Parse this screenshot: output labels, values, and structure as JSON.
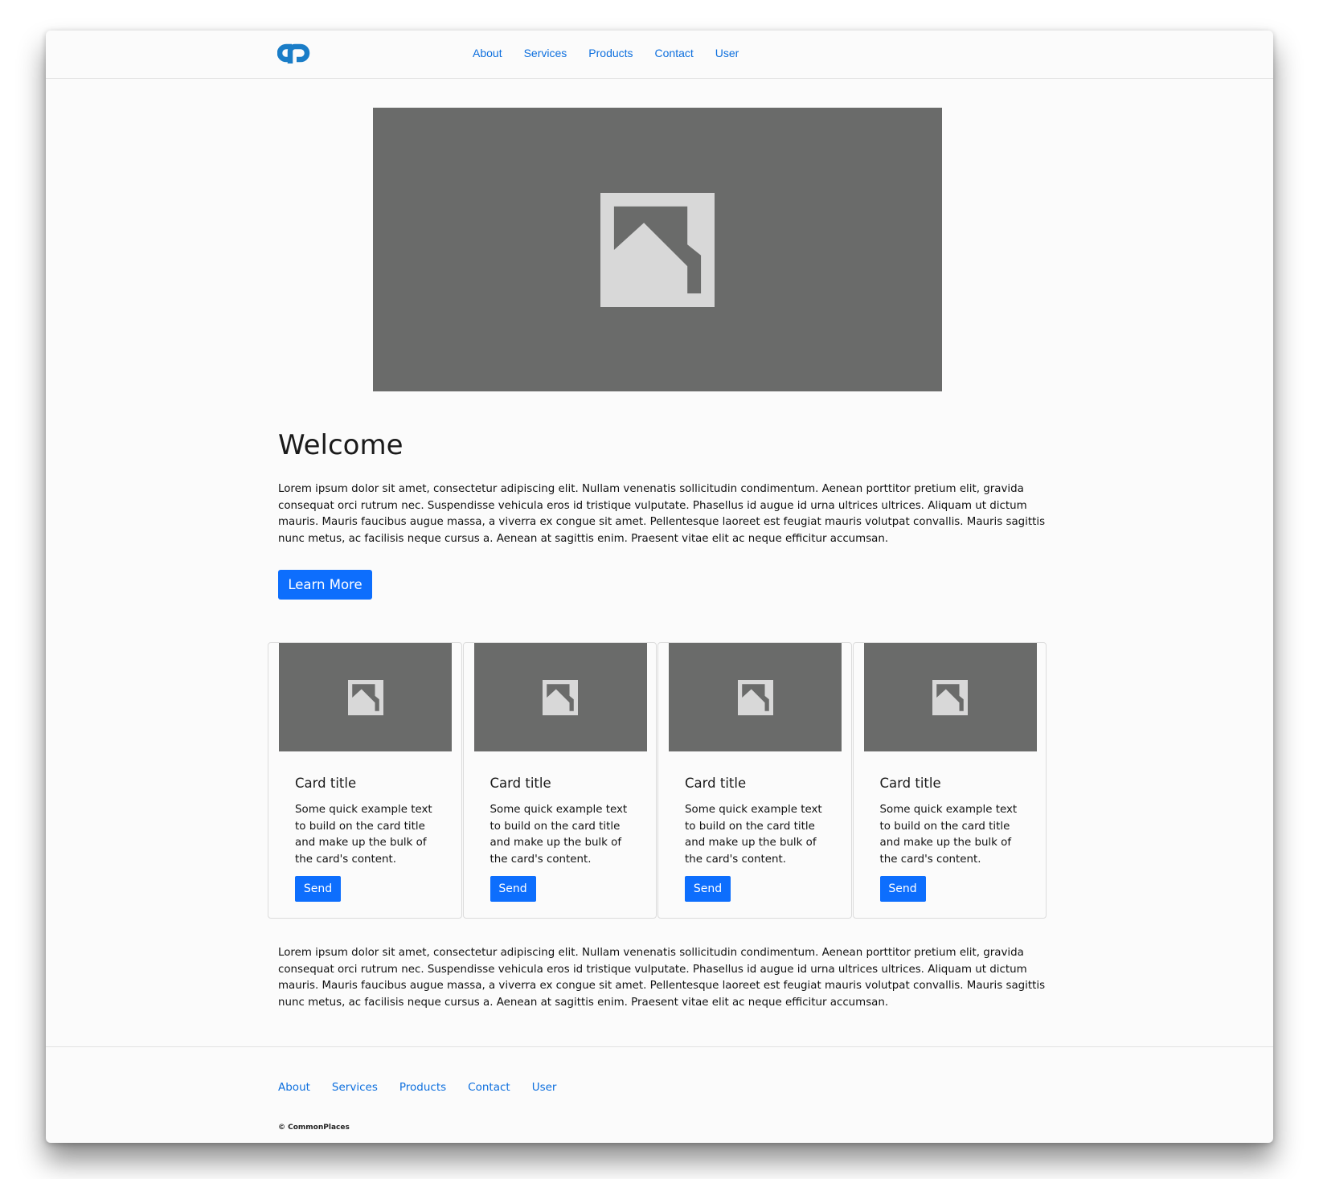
{
  "brand": {
    "logo_icon": "commonplaces-logo-icon",
    "color": "#1a7dc7"
  },
  "nav": {
    "items": [
      {
        "label": "About"
      },
      {
        "label": "Services"
      },
      {
        "label": "Products"
      },
      {
        "label": "Contact"
      },
      {
        "label": "User"
      }
    ]
  },
  "hero": {
    "image_icon": "image-placeholder-icon"
  },
  "welcome": {
    "title": "Welcome",
    "paragraph": "Lorem ipsum dolor sit amet, consectetur adipiscing elit. Nullam venenatis sollicitudin condimentum. Aenean porttitor pretium elit, gravida consequat orci rutrum nec. Suspendisse vehicula eros id tristique vulputate. Phasellus id augue id urna ultrices ultrices. Aliquam ut dictum mauris. Mauris faucibus augue massa, a viverra ex congue sit amet. Pellentesque laoreet est feugiat mauris volutpat convallis. Mauris sagittis nunc metus, ac facilisis neque cursus a. Aenean at sagittis enim. Praesent vitae elit ac neque efficitur accumsan.",
    "button_label": "Learn More"
  },
  "cards": [
    {
      "title": "Card title",
      "text": "Some quick example text to build on the card title and make up the bulk of the card's content.",
      "button_label": "Send"
    },
    {
      "title": "Card title",
      "text": "Some quick example text to build on the card title and make up the bulk of the card's content.",
      "button_label": "Send"
    },
    {
      "title": "Card title",
      "text": "Some quick example text to build on the card title and make up the bulk of the card's content.",
      "button_label": "Send"
    },
    {
      "title": "Card title",
      "text": "Some quick example text to build on the card title and make up the bulk of the card's content.",
      "button_label": "Send"
    }
  ],
  "bottom": {
    "paragraph": "Lorem ipsum dolor sit amet, consectetur adipiscing elit. Nullam venenatis sollicitudin condimentum. Aenean porttitor pretium elit, gravida consequat orci rutrum nec. Suspendisse vehicula eros id tristique vulputate. Phasellus id augue id urna ultrices ultrices. Aliquam ut dictum mauris. Mauris faucibus augue massa, a viverra ex congue sit amet. Pellentesque laoreet est feugiat mauris volutpat convallis. Mauris sagittis nunc metus, ac facilisis neque cursus a. Aenean at sagittis enim. Praesent vitae elit ac neque efficitur accumsan."
  },
  "footer": {
    "items": [
      {
        "label": "About"
      },
      {
        "label": "Services"
      },
      {
        "label": "Products"
      },
      {
        "label": "Contact"
      },
      {
        "label": "User"
      }
    ],
    "copyright": "© CommonPlaces"
  },
  "colors": {
    "accent": "#0d6efd",
    "link": "#0d6fde",
    "placeholder_bg": "#6a6b6a",
    "placeholder_icon": "#d8d8d8",
    "page_bg": "#fbfbfb"
  }
}
